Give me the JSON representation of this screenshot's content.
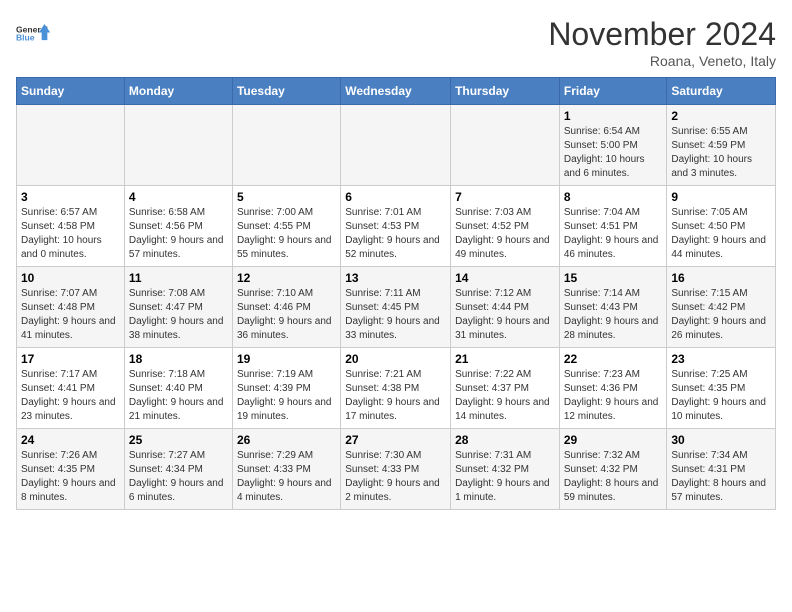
{
  "logo": {
    "line1": "General",
    "line2": "Blue"
  },
  "header": {
    "month": "November 2024",
    "location": "Roana, Veneto, Italy"
  },
  "days_of_week": [
    "Sunday",
    "Monday",
    "Tuesday",
    "Wednesday",
    "Thursday",
    "Friday",
    "Saturday"
  ],
  "weeks": [
    [
      {
        "day": "",
        "info": ""
      },
      {
        "day": "",
        "info": ""
      },
      {
        "day": "",
        "info": ""
      },
      {
        "day": "",
        "info": ""
      },
      {
        "day": "",
        "info": ""
      },
      {
        "day": "1",
        "info": "Sunrise: 6:54 AM\nSunset: 5:00 PM\nDaylight: 10 hours and 6 minutes."
      },
      {
        "day": "2",
        "info": "Sunrise: 6:55 AM\nSunset: 4:59 PM\nDaylight: 10 hours and 3 minutes."
      }
    ],
    [
      {
        "day": "3",
        "info": "Sunrise: 6:57 AM\nSunset: 4:58 PM\nDaylight: 10 hours and 0 minutes."
      },
      {
        "day": "4",
        "info": "Sunrise: 6:58 AM\nSunset: 4:56 PM\nDaylight: 9 hours and 57 minutes."
      },
      {
        "day": "5",
        "info": "Sunrise: 7:00 AM\nSunset: 4:55 PM\nDaylight: 9 hours and 55 minutes."
      },
      {
        "day": "6",
        "info": "Sunrise: 7:01 AM\nSunset: 4:53 PM\nDaylight: 9 hours and 52 minutes."
      },
      {
        "day": "7",
        "info": "Sunrise: 7:03 AM\nSunset: 4:52 PM\nDaylight: 9 hours and 49 minutes."
      },
      {
        "day": "8",
        "info": "Sunrise: 7:04 AM\nSunset: 4:51 PM\nDaylight: 9 hours and 46 minutes."
      },
      {
        "day": "9",
        "info": "Sunrise: 7:05 AM\nSunset: 4:50 PM\nDaylight: 9 hours and 44 minutes."
      }
    ],
    [
      {
        "day": "10",
        "info": "Sunrise: 7:07 AM\nSunset: 4:48 PM\nDaylight: 9 hours and 41 minutes."
      },
      {
        "day": "11",
        "info": "Sunrise: 7:08 AM\nSunset: 4:47 PM\nDaylight: 9 hours and 38 minutes."
      },
      {
        "day": "12",
        "info": "Sunrise: 7:10 AM\nSunset: 4:46 PM\nDaylight: 9 hours and 36 minutes."
      },
      {
        "day": "13",
        "info": "Sunrise: 7:11 AM\nSunset: 4:45 PM\nDaylight: 9 hours and 33 minutes."
      },
      {
        "day": "14",
        "info": "Sunrise: 7:12 AM\nSunset: 4:44 PM\nDaylight: 9 hours and 31 minutes."
      },
      {
        "day": "15",
        "info": "Sunrise: 7:14 AM\nSunset: 4:43 PM\nDaylight: 9 hours and 28 minutes."
      },
      {
        "day": "16",
        "info": "Sunrise: 7:15 AM\nSunset: 4:42 PM\nDaylight: 9 hours and 26 minutes."
      }
    ],
    [
      {
        "day": "17",
        "info": "Sunrise: 7:17 AM\nSunset: 4:41 PM\nDaylight: 9 hours and 23 minutes."
      },
      {
        "day": "18",
        "info": "Sunrise: 7:18 AM\nSunset: 4:40 PM\nDaylight: 9 hours and 21 minutes."
      },
      {
        "day": "19",
        "info": "Sunrise: 7:19 AM\nSunset: 4:39 PM\nDaylight: 9 hours and 19 minutes."
      },
      {
        "day": "20",
        "info": "Sunrise: 7:21 AM\nSunset: 4:38 PM\nDaylight: 9 hours and 17 minutes."
      },
      {
        "day": "21",
        "info": "Sunrise: 7:22 AM\nSunset: 4:37 PM\nDaylight: 9 hours and 14 minutes."
      },
      {
        "day": "22",
        "info": "Sunrise: 7:23 AM\nSunset: 4:36 PM\nDaylight: 9 hours and 12 minutes."
      },
      {
        "day": "23",
        "info": "Sunrise: 7:25 AM\nSunset: 4:35 PM\nDaylight: 9 hours and 10 minutes."
      }
    ],
    [
      {
        "day": "24",
        "info": "Sunrise: 7:26 AM\nSunset: 4:35 PM\nDaylight: 9 hours and 8 minutes."
      },
      {
        "day": "25",
        "info": "Sunrise: 7:27 AM\nSunset: 4:34 PM\nDaylight: 9 hours and 6 minutes."
      },
      {
        "day": "26",
        "info": "Sunrise: 7:29 AM\nSunset: 4:33 PM\nDaylight: 9 hours and 4 minutes."
      },
      {
        "day": "27",
        "info": "Sunrise: 7:30 AM\nSunset: 4:33 PM\nDaylight: 9 hours and 2 minutes."
      },
      {
        "day": "28",
        "info": "Sunrise: 7:31 AM\nSunset: 4:32 PM\nDaylight: 9 hours and 1 minute."
      },
      {
        "day": "29",
        "info": "Sunrise: 7:32 AM\nSunset: 4:32 PM\nDaylight: 8 hours and 59 minutes."
      },
      {
        "day": "30",
        "info": "Sunrise: 7:34 AM\nSunset: 4:31 PM\nDaylight: 8 hours and 57 minutes."
      }
    ]
  ]
}
